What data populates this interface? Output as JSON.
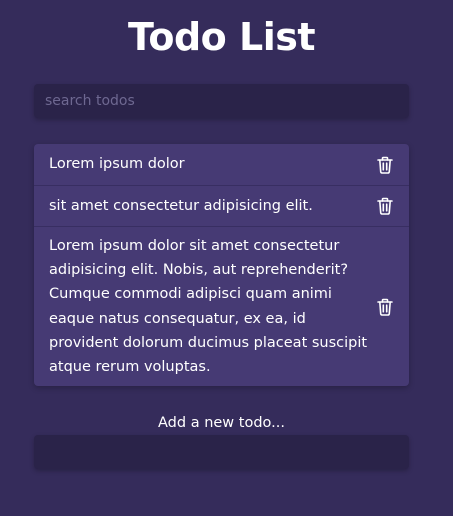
{
  "title": "Todo List",
  "search": {
    "placeholder": "search todos",
    "value": ""
  },
  "todos": [
    {
      "text": "Lorem ipsum dolor",
      "delete_icon": "trash-icon"
    },
    {
      "text": "sit amet consectetur adipisicing elit.",
      "delete_icon": "trash-icon"
    },
    {
      "text": "Lorem ipsum dolor sit amet consectetur adipisicing elit. Nobis, aut reprehenderit? Cumque commodi adipisci quam animi eaque natus consequatur, ex ea, id provident dolorum ducimus placeat suscipit atque rerum voluptas.",
      "delete_icon": "trash-icon"
    }
  ],
  "add": {
    "label": "Add a new todo...",
    "value": ""
  },
  "colors": {
    "background": "#352c5b",
    "list_background": "#463a74",
    "input_background": "#2a2349",
    "text": "#ffffff",
    "placeholder": "#6e6891"
  }
}
